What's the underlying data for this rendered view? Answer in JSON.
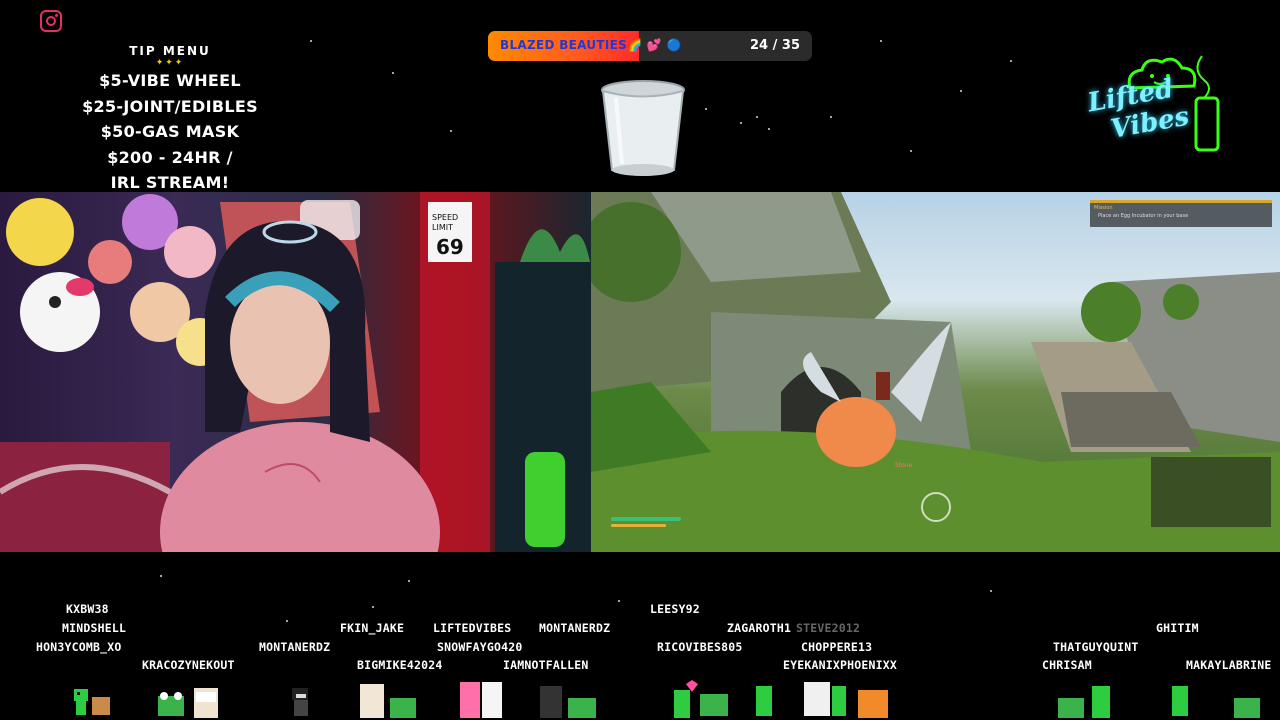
{
  "social": {
    "icon": "instagram-icon",
    "color": "#e1306c"
  },
  "tip_menu": {
    "title": "TIP MENU",
    "sparkle": "✦✦✦",
    "items": [
      "$5-VIBE WHEEL",
      "$25-JOINT/EDIBLES",
      "$50-GAS MASK",
      "$200 - 24HR /",
      "IRL STREAM!"
    ]
  },
  "goal": {
    "name": "BLAZED BEAUTIES🌈 💕 🔵",
    "current": 24,
    "target": 35,
    "count_text": "24 / 35",
    "accent": "#ff6a00"
  },
  "logo": {
    "line1": "Lifted",
    "line2": "Vibes",
    "color": "#39ff14",
    "text_color": "#7ef0ff"
  },
  "game": {
    "objective_title": "Mission",
    "objective_text": "Place an Egg Incubator in your base",
    "prompt": "Stone"
  },
  "chat": {
    "viewers": [
      {
        "name": "KXBW38"
      },
      {
        "name": "MINDSHELL"
      },
      {
        "name": "HON3YCOMB_XO"
      },
      {
        "name": "KRACOZYNEKOUT"
      },
      {
        "name": "MONTANERDZ"
      },
      {
        "name": "FKIN_JAKE"
      },
      {
        "name": "BIGMIKE42024"
      },
      {
        "name": "LIFTEDVIBES"
      },
      {
        "name": "SNOWFAYGO420"
      },
      {
        "name": "IAMNOTFALLEN"
      },
      {
        "name": "MONTANERDZ"
      },
      {
        "name": "LEESY92"
      },
      {
        "name": "RICOVIBES805"
      },
      {
        "name": "ZAGAROTH1"
      },
      {
        "name": "STEVE2012"
      },
      {
        "name": "CHOPPERE13"
      },
      {
        "name": "EYEKANIXPHOENIXX"
      },
      {
        "name": "GHITIM"
      },
      {
        "name": "THATGUYQUINT"
      },
      {
        "name": "CHRISAM"
      },
      {
        "name": "MAKAYLABRINE"
      }
    ]
  }
}
